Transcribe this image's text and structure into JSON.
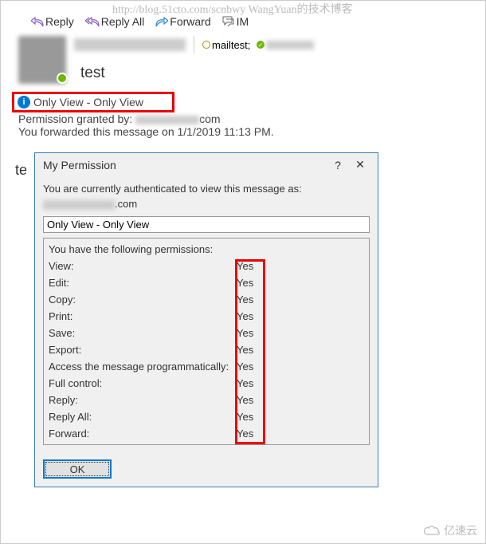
{
  "watermark": {
    "url": "http://blog.51cto.com/scnbwy WangYuan的技术博客",
    "logo": "亿速云"
  },
  "toolbar": {
    "reply": "Reply",
    "reply_all": "Reply All",
    "forward": "Forward",
    "im": "IM"
  },
  "header": {
    "recipient1": "mailtest;",
    "subject": "test"
  },
  "banner": {
    "text": "Only View - Only View"
  },
  "meta": {
    "granted_prefix": "Permission granted by: ",
    "granted_suffix": "com",
    "forwarded": "You forwarded this message on 1/1/2019 11:13 PM."
  },
  "body": {
    "cutoff": "te"
  },
  "dialog": {
    "title": "My Permission",
    "help": "?",
    "close": "✕",
    "auth_line": "You are currently authenticated to view this message as:",
    "email_suffix": ".com",
    "template_value": "Only View - Only View",
    "perm_header": "You have the following permissions:",
    "permissions": [
      {
        "label": "View:",
        "value": "Yes"
      },
      {
        "label": "Edit:",
        "value": "Yes"
      },
      {
        "label": "Copy:",
        "value": "Yes"
      },
      {
        "label": "Print:",
        "value": "Yes"
      },
      {
        "label": "Save:",
        "value": "Yes"
      },
      {
        "label": "Export:",
        "value": "Yes"
      },
      {
        "label": "Access the message programmatically:",
        "value": "Yes"
      },
      {
        "label": "Full control:",
        "value": "Yes"
      },
      {
        "label": "Reply:",
        "value": "Yes"
      },
      {
        "label": "Reply All:",
        "value": "Yes"
      },
      {
        "label": "Forward:",
        "value": "Yes"
      }
    ],
    "ok": "OK"
  },
  "colors": {
    "accent": "#0078d4",
    "highlight": "#ee0000",
    "presence": "#6bb700"
  }
}
